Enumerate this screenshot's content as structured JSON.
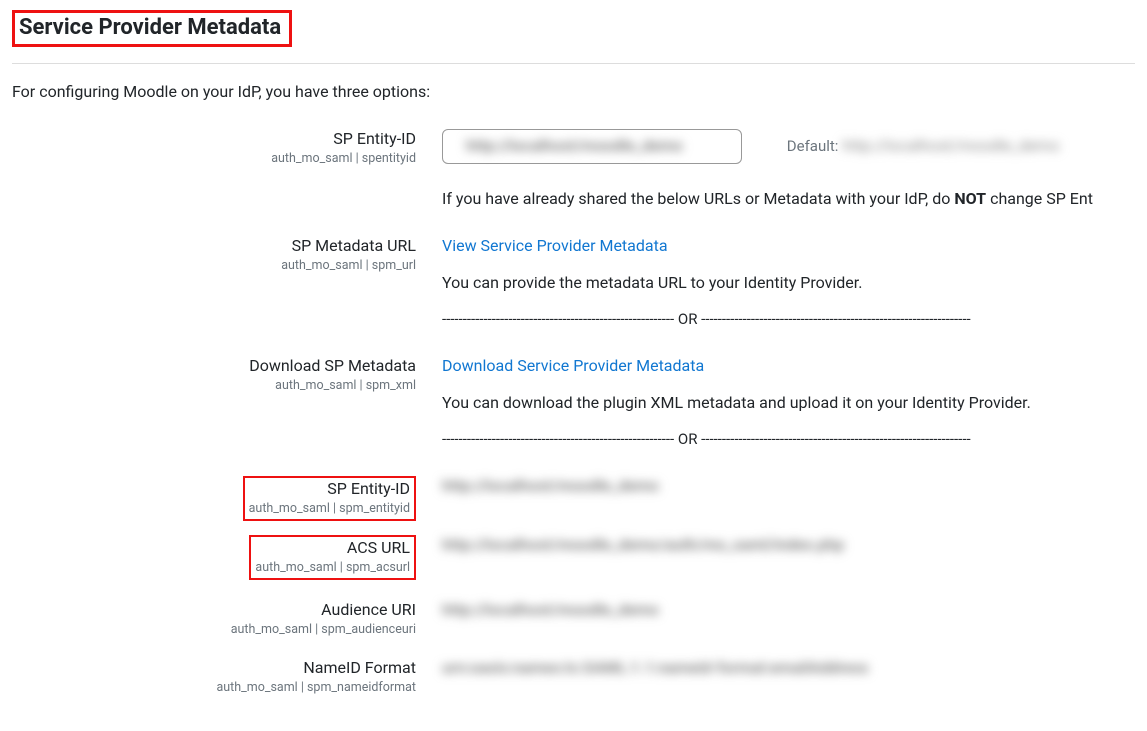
{
  "section_title": "Service Provider Metadata",
  "intro": "For configuring Moodle on your IdP, you have three options:",
  "fields": {
    "sp_entity_id": {
      "label": "SP Entity-ID",
      "sub": "auth_mo_saml | spentityid",
      "value": "http://localhost/moodle_demo",
      "default_prefix": "Default:",
      "default_value": "http://localhost/moodle_demo"
    },
    "warning": {
      "prefix": "If you have already shared the below URLs or Metadata with your IdP, do ",
      "bold": "NOT",
      "suffix": " change SP Ent"
    },
    "sp_metadata_url": {
      "label": "SP Metadata URL",
      "sub": "auth_mo_saml | spm_url",
      "link": "View Service Provider Metadata",
      "desc": "You can provide the metadata URL to your Identity Provider."
    },
    "or_sep": "-------------------------------------------------------- OR -----------------------------------------------------------------",
    "download_sp": {
      "label": "Download SP Metadata",
      "sub": "auth_mo_saml | spm_xml",
      "link": "Download Service Provider Metadata",
      "desc": "You can download the plugin XML metadata and upload it on your Identity Provider."
    },
    "spm_entity_id": {
      "label": "SP Entity-ID",
      "sub": "auth_mo_saml | spm_entityid",
      "value": "http://localhost/moodle_demo"
    },
    "acs_url": {
      "label": "ACS URL",
      "sub": "auth_mo_saml | spm_acsurl",
      "value": "http://localhost/moodle_demo/auth/mo_saml/index.php"
    },
    "audience_uri": {
      "label": "Audience URI",
      "sub": "auth_mo_saml | spm_audienceuri",
      "value": "http://localhost/moodle_demo"
    },
    "nameid_format": {
      "label": "NameID Format",
      "sub": "auth_mo_saml | spm_nameidformat",
      "value": "urn:oasis:names:tc:SAML:1.1:nameid-format:emailAddress"
    }
  }
}
